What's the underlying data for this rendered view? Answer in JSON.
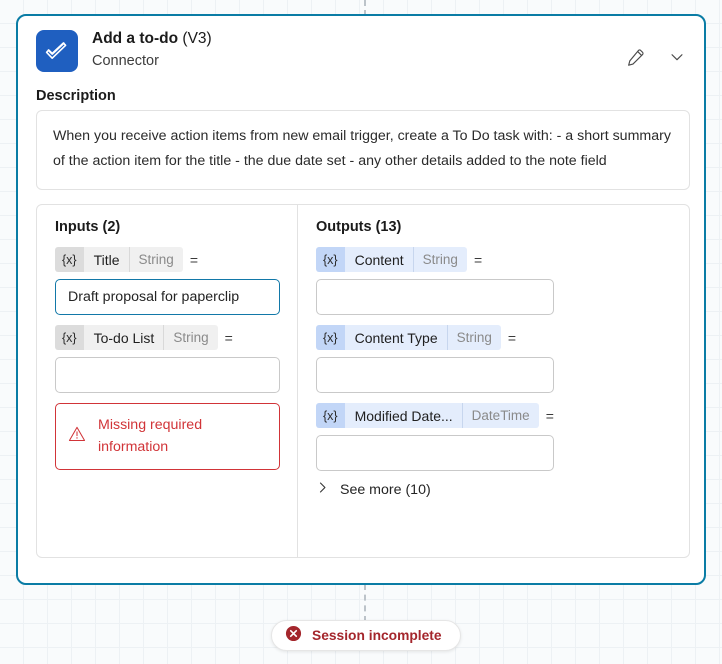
{
  "connectors": {
    "top": "dashed-line",
    "bottom": "dashed-line"
  },
  "card": {
    "border_color": "#0a7ca5",
    "header": {
      "icon": "todo-check-icon",
      "title": "Add a to-do ",
      "version": "(V3)",
      "subtitle": "Connector",
      "actions": [
        {
          "name": "edit-pencil-icon",
          "label": "Edit"
        },
        {
          "name": "chevron-down-icon",
          "label": "Collapse"
        }
      ]
    },
    "description": {
      "label": "Description",
      "text": "When you receive action items from new email trigger, create a To Do task with: - a short summary of the action item for the title - the due date set - any other details added to the note field"
    },
    "inputs": {
      "title": "Inputs (2)",
      "rows": [
        {
          "token": "{x}",
          "name": "Title",
          "type": "String",
          "equals": "=",
          "value": "Draft proposal for paperclip",
          "focused": true
        },
        {
          "token": "{x}",
          "name": "To-do List",
          "type": "String",
          "equals": "=",
          "value": "",
          "focused": false
        }
      ],
      "error": {
        "icon": "warning-triangle-icon",
        "text": "Missing required information",
        "color": "#d13438"
      }
    },
    "outputs": {
      "title": "Outputs (13)",
      "rows": [
        {
          "token": "{x}",
          "name": "Content",
          "type": "String",
          "equals": "=",
          "value": ""
        },
        {
          "token": "{x}",
          "name": "Content Type",
          "type": "String",
          "equals": "=",
          "value": ""
        },
        {
          "token": "{x}",
          "name": "Modified Date...",
          "type": "DateTime",
          "equals": "=",
          "value": ""
        }
      ],
      "see_more": {
        "icon": "chevron-right-icon",
        "label": "See more (10)"
      }
    }
  },
  "status": {
    "icon": "error-circle-icon",
    "label": "Session incomplete",
    "color": "#a4262c"
  }
}
